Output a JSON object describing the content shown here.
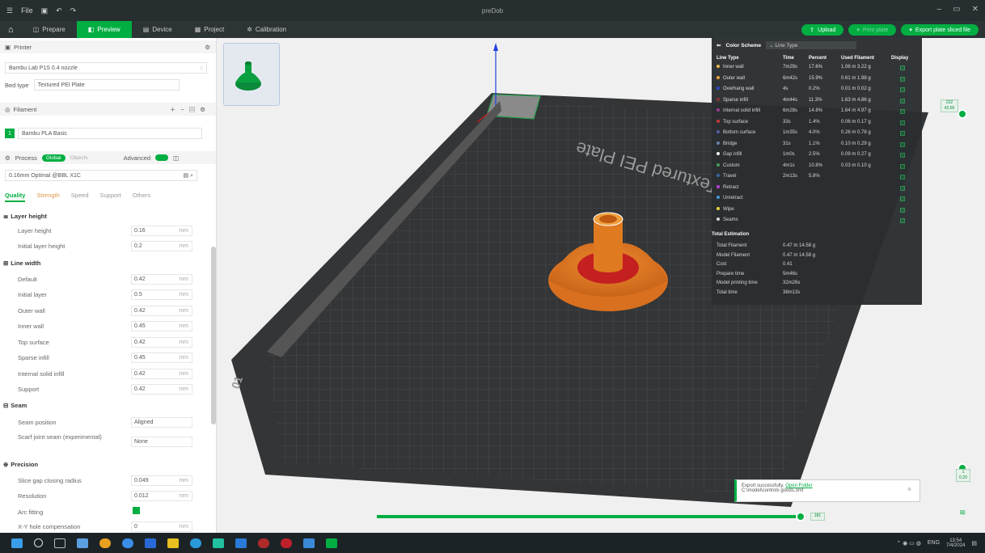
{
  "window": {
    "title": "preDob",
    "menu_label": "File",
    "ctl_min": "–",
    "ctl_max": "▭",
    "ctl_close": "✕"
  },
  "tabs": [
    {
      "label": "Prepare"
    },
    {
      "label": "Preview"
    },
    {
      "label": "Device"
    },
    {
      "label": "Project"
    },
    {
      "label": "Calibration"
    }
  ],
  "top_buttons": {
    "upload": "Upload",
    "print": "Print plate",
    "export": "Export plate sliced file"
  },
  "printer": {
    "section": "Printer",
    "name": "Bambu Lab P1S 0.4 nozzle",
    "bed_label": "Bed type",
    "bed_value": "Textured PEI Plate"
  },
  "filament": {
    "section": "Filament",
    "item": "Bambu PLA Basic",
    "index": "1"
  },
  "process": {
    "section": "Process",
    "toggle_global": "Global",
    "toggle_objects": "Objects",
    "advanced": "Advanced",
    "profile": "0.16mm Optimal @BBL X1C"
  },
  "quality_tabs": [
    "Quality",
    "Strength",
    "Speed",
    "Support",
    "Others"
  ],
  "groups": {
    "layer_height": "Layer height",
    "line_width": "Line width",
    "seam": "Seam",
    "precision": "Precision"
  },
  "params": {
    "layer_height": [
      {
        "label": "Layer height",
        "value": "0.16",
        "unit": "mm"
      },
      {
        "label": "Initial layer height",
        "value": "0.2",
        "unit": "mm"
      }
    ],
    "line_width": [
      {
        "label": "Default",
        "value": "0.42",
        "unit": "mm"
      },
      {
        "label": "Initial layer",
        "value": "0.5",
        "unit": "mm"
      },
      {
        "label": "Outer wall",
        "value": "0.42",
        "unit": "mm"
      },
      {
        "label": "Inner wall",
        "value": "0.45",
        "unit": "mm"
      },
      {
        "label": "Top surface",
        "value": "0.42",
        "unit": "mm"
      },
      {
        "label": "Sparse infill",
        "value": "0.45",
        "unit": "mm"
      },
      {
        "label": "Internal solid infill",
        "value": "0.42",
        "unit": "mm"
      },
      {
        "label": "Support",
        "value": "0.42",
        "unit": "mm"
      }
    ],
    "seam": [
      {
        "label": "Seam position",
        "value": "Aligned"
      },
      {
        "label": "Scarf joint seam (experimental)",
        "value": "None"
      }
    ],
    "precision": [
      {
        "label": "Slice gap closing radius",
        "value": "0.049",
        "unit": "mm"
      },
      {
        "label": "Resolution",
        "value": "0.012",
        "unit": "mm"
      },
      {
        "label": "Arc fitting",
        "value": ""
      },
      {
        "label": "X-Y hole compensation",
        "value": "0",
        "unit": "mm"
      }
    ]
  },
  "legend": {
    "title": "Color Scheme",
    "scheme": "Line Type",
    "headers": [
      "Line Type",
      "Time",
      "Percent",
      "Used Filament",
      "Display"
    ],
    "rows": [
      {
        "name": "Inner wall",
        "color": "#e8b84a",
        "time": "7m29s",
        "percent": "17.6%",
        "used": "1.06 m  3.22 g"
      },
      {
        "name": "Outer wall",
        "color": "#f0a030",
        "time": "6m42s",
        "percent": "15.9%",
        "used": "0.61 m  1.98 g"
      },
      {
        "name": "Overhang wall",
        "color": "#2244cc",
        "time": "4s",
        "percent": "0.2%",
        "used": "0.01 m  0.02 g"
      },
      {
        "name": "Sparse infill",
        "color": "#8a2a2a",
        "time": "4m44s",
        "percent": "11.3%",
        "used": "1.63 m  4.86 g"
      },
      {
        "name": "Internal solid infill",
        "color": "#a03a9a",
        "time": "6m28s",
        "percent": "14.8%",
        "used": "1.64 m  4.97 g"
      },
      {
        "name": "Top surface",
        "color": "#d03a3a",
        "time": "33s",
        "percent": "1.4%",
        "used": "0.06 m  0.17 g"
      },
      {
        "name": "Bottom surface",
        "color": "#5a60a8",
        "time": "1m35s",
        "percent": "4.0%",
        "used": "0.26 m  0.78 g"
      },
      {
        "name": "Bridge",
        "color": "#6a86b8",
        "time": "31s",
        "percent": "1.1%",
        "used": "0.10 m  0.29 g"
      },
      {
        "name": "Gap infill",
        "color": "#ffffff",
        "time": "1m0s",
        "percent": "2.5%",
        "used": "0.09 m  0.27 g"
      },
      {
        "name": "Custom",
        "color": "#4aa060",
        "time": "4m1s",
        "percent": "10.8%",
        "used": "0.03 m  0.10 g"
      },
      {
        "name": "Travel",
        "color": "#3a6aaa",
        "time": "2m13s",
        "percent": "5.8%",
        "used": ""
      },
      {
        "name": "Retract",
        "color": "#c040e0",
        "time": "",
        "percent": "",
        "used": ""
      },
      {
        "name": "Unretract",
        "color": "#40a0e0",
        "time": "",
        "percent": "",
        "used": ""
      },
      {
        "name": "Wipe",
        "color": "#f0e040",
        "time": "",
        "percent": "",
        "used": ""
      },
      {
        "name": "Seams",
        "color": "#e0e0e0",
        "time": "",
        "percent": "",
        "used": ""
      }
    ],
    "total_title": "Total Estimation",
    "totals": [
      {
        "label": "Total Filament",
        "value": "0.47 m   14.58 g"
      },
      {
        "label": "Model Filament",
        "value": "0.47 m   14.58 g"
      },
      {
        "label": "Cost",
        "value": "0.41"
      },
      {
        "label": "Prepare time",
        "value": "5m46s"
      },
      {
        "label": "Model printing time",
        "value": "32m26s"
      },
      {
        "label": "Total time",
        "value": "38m13s"
      }
    ]
  },
  "plate": {
    "label": "Textured PEI Plate",
    "number": "01"
  },
  "vslider": {
    "top_label": "222\n42.06",
    "bottom_label": "1\n0.20"
  },
  "hslider": {
    "value_label": "181"
  },
  "notice": {
    "text": "Export successfully.",
    "link": "Open Folder",
    "file": "C:\\model\\controls goods.3mf"
  },
  "taskbar": {
    "time": "13:54",
    "date": "7/4/2024",
    "lang": "ENG"
  },
  "colors": {
    "accent": "#00ae42",
    "model": "#e07a20"
  }
}
